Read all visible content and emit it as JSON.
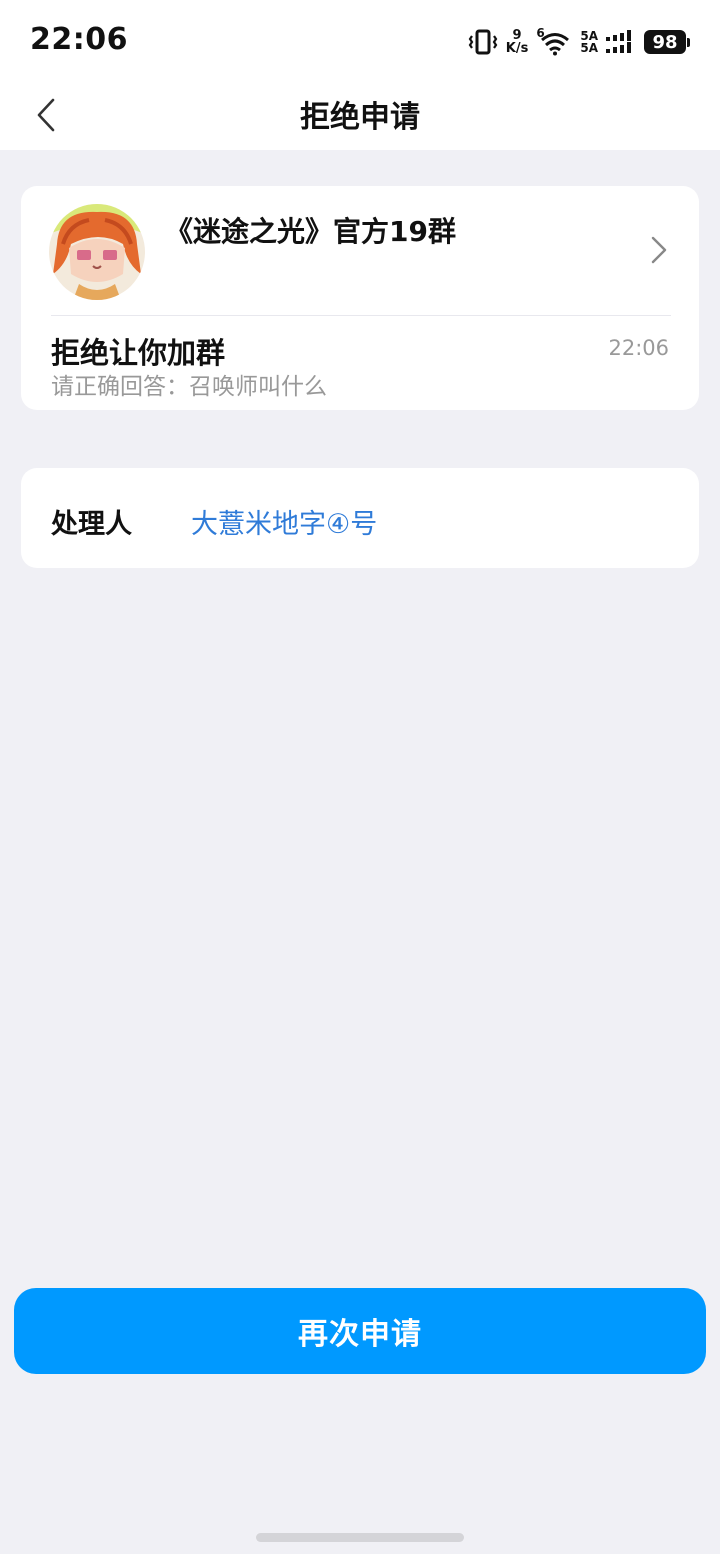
{
  "status_bar": {
    "time": "22:06",
    "net_speed_value": "9",
    "net_speed_unit": "K/s",
    "wifi_label": "6",
    "signal_label_1": "5A",
    "signal_label_2": "5A",
    "battery": "98"
  },
  "header": {
    "title": "拒绝申请"
  },
  "group": {
    "name": "《迷途之光》官方19群"
  },
  "request": {
    "status_title": "拒绝让你加群",
    "detail": "请正确回答：召唤师叫什么",
    "time": "22:06"
  },
  "handler": {
    "label": "处理人",
    "name": "大薏米地字④号"
  },
  "action": {
    "reapply_label": "再次申请"
  },
  "colors": {
    "primary_button": "#0099ff",
    "link": "#2f7bd8",
    "page_bg": "#f0f0f5"
  }
}
